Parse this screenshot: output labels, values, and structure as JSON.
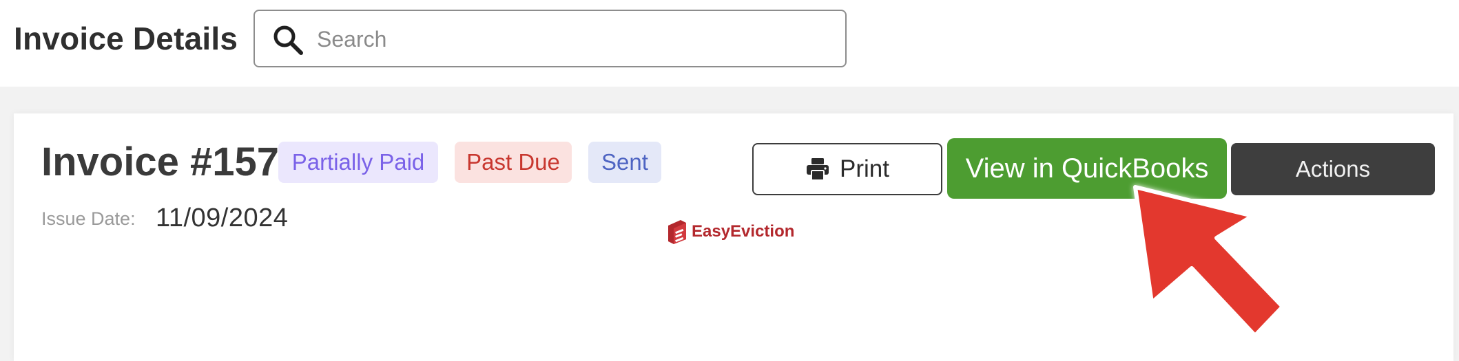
{
  "header": {
    "title": "Invoice Details",
    "search_placeholder": "Search",
    "search_value": "",
    "search_icon": "search-icon"
  },
  "invoice": {
    "title": "Invoice #157",
    "badges": [
      {
        "label": "Partially Paid",
        "color": "#7a62e8",
        "bg": "#ebe7fd"
      },
      {
        "label": "Past Due",
        "color": "#c8372f",
        "bg": "#fbe2e0"
      },
      {
        "label": "Sent",
        "color": "#4e64c2",
        "bg": "#e4e8f8"
      }
    ],
    "issue_date_label": "Issue Date:",
    "issue_date_value": "11/09/2024"
  },
  "watermark": {
    "text": "EasyEviction",
    "color": "#b3282d"
  },
  "toolbar": {
    "print_label": "Print",
    "print_icon": "printer-icon",
    "quickbooks_label": "View in QuickBooks",
    "quickbooks_color": "#4d9d31",
    "actions_label": "Actions"
  },
  "annotation": {
    "arrow_color": "#e3382e",
    "arrow_icon": "pointer-arrow-icon"
  }
}
